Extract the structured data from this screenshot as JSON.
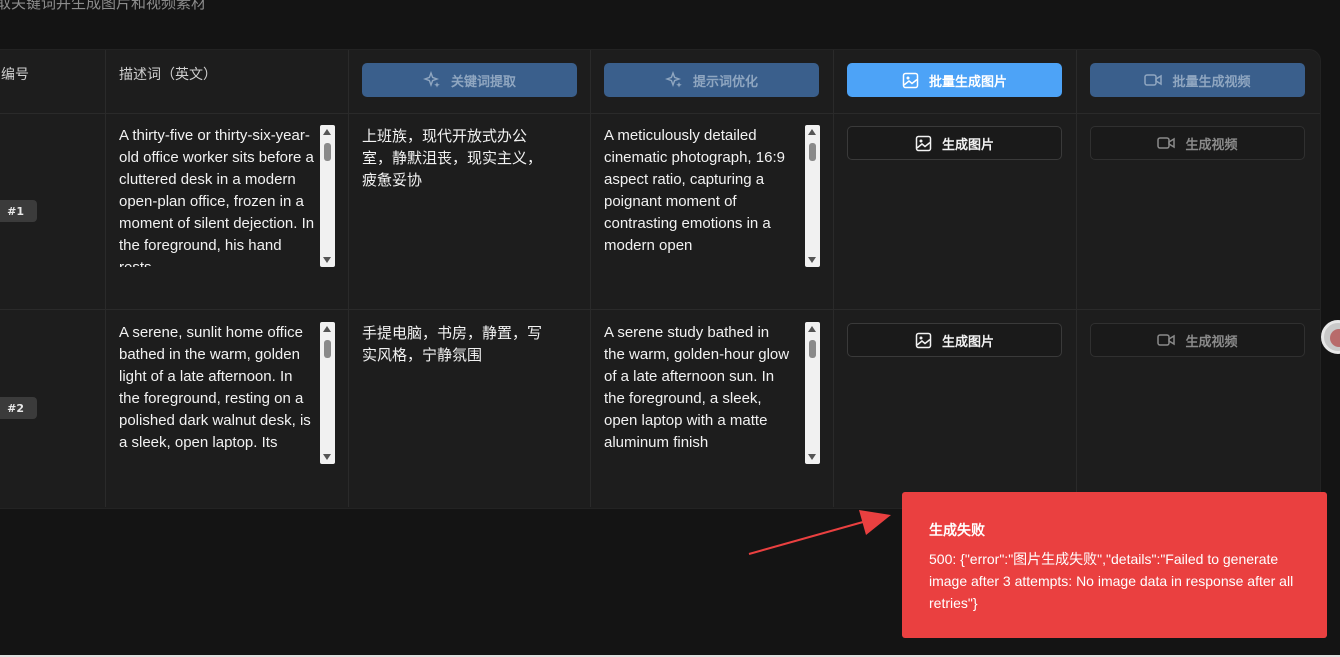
{
  "page": {
    "subtitle": "取关键词并生成图片和视频素材"
  },
  "table": {
    "headers": {
      "index": "编号",
      "description": "描述词（英文）",
      "keyword_extract": "关键词提取",
      "prompt_optimize": "提示词优化",
      "batch_image": "批量生成图片",
      "batch_video": "批量生成视频"
    },
    "rows": [
      {
        "tag": "#1",
        "description": "A thirty-five or thirty-six-year-old office worker sits before a cluttered desk in a modern open-plan office, frozen in a moment of silent dejection. In the foreground, his hand rests",
        "keywords": "上班族，现代开放式办公室，静默沮丧，现实主义，疲惫妥协",
        "optimized": "A meticulously detailed cinematic photograph, 16:9 aspect ratio, capturing a poignant moment of contrasting emotions in a modern open",
        "image_btn": "生成图片",
        "video_btn": "生成视频"
      },
      {
        "tag": "#2",
        "description": "A serene, sunlit home office bathed in the warm, golden light of a late afternoon. In the foreground, resting on a polished dark walnut desk, is a sleek, open laptop. Its",
        "keywords": "手提电脑，书房，静置，写实风格，宁静氛围",
        "optimized": "A serene study bathed in the warm, golden-hour glow of a late afternoon sun. In the foreground, a sleek, open laptop with a matte aluminum finish",
        "image_btn": "生成图片",
        "video_btn": "生成视频"
      }
    ]
  },
  "toast": {
    "title": "生成失败",
    "message": "500: {\"error\":\"图片生成失败\",\"details\":\"Failed to generate image after 3 attempts: No image data in response after all retries\"}"
  },
  "colors": {
    "primary": "#4da3f7",
    "disabled_primary": "#3a5f8c",
    "error": "#ea4040",
    "background": "#141414"
  },
  "icons": [
    "sparkle-icon",
    "image-icon",
    "video-icon",
    "arrow-annotation"
  ]
}
